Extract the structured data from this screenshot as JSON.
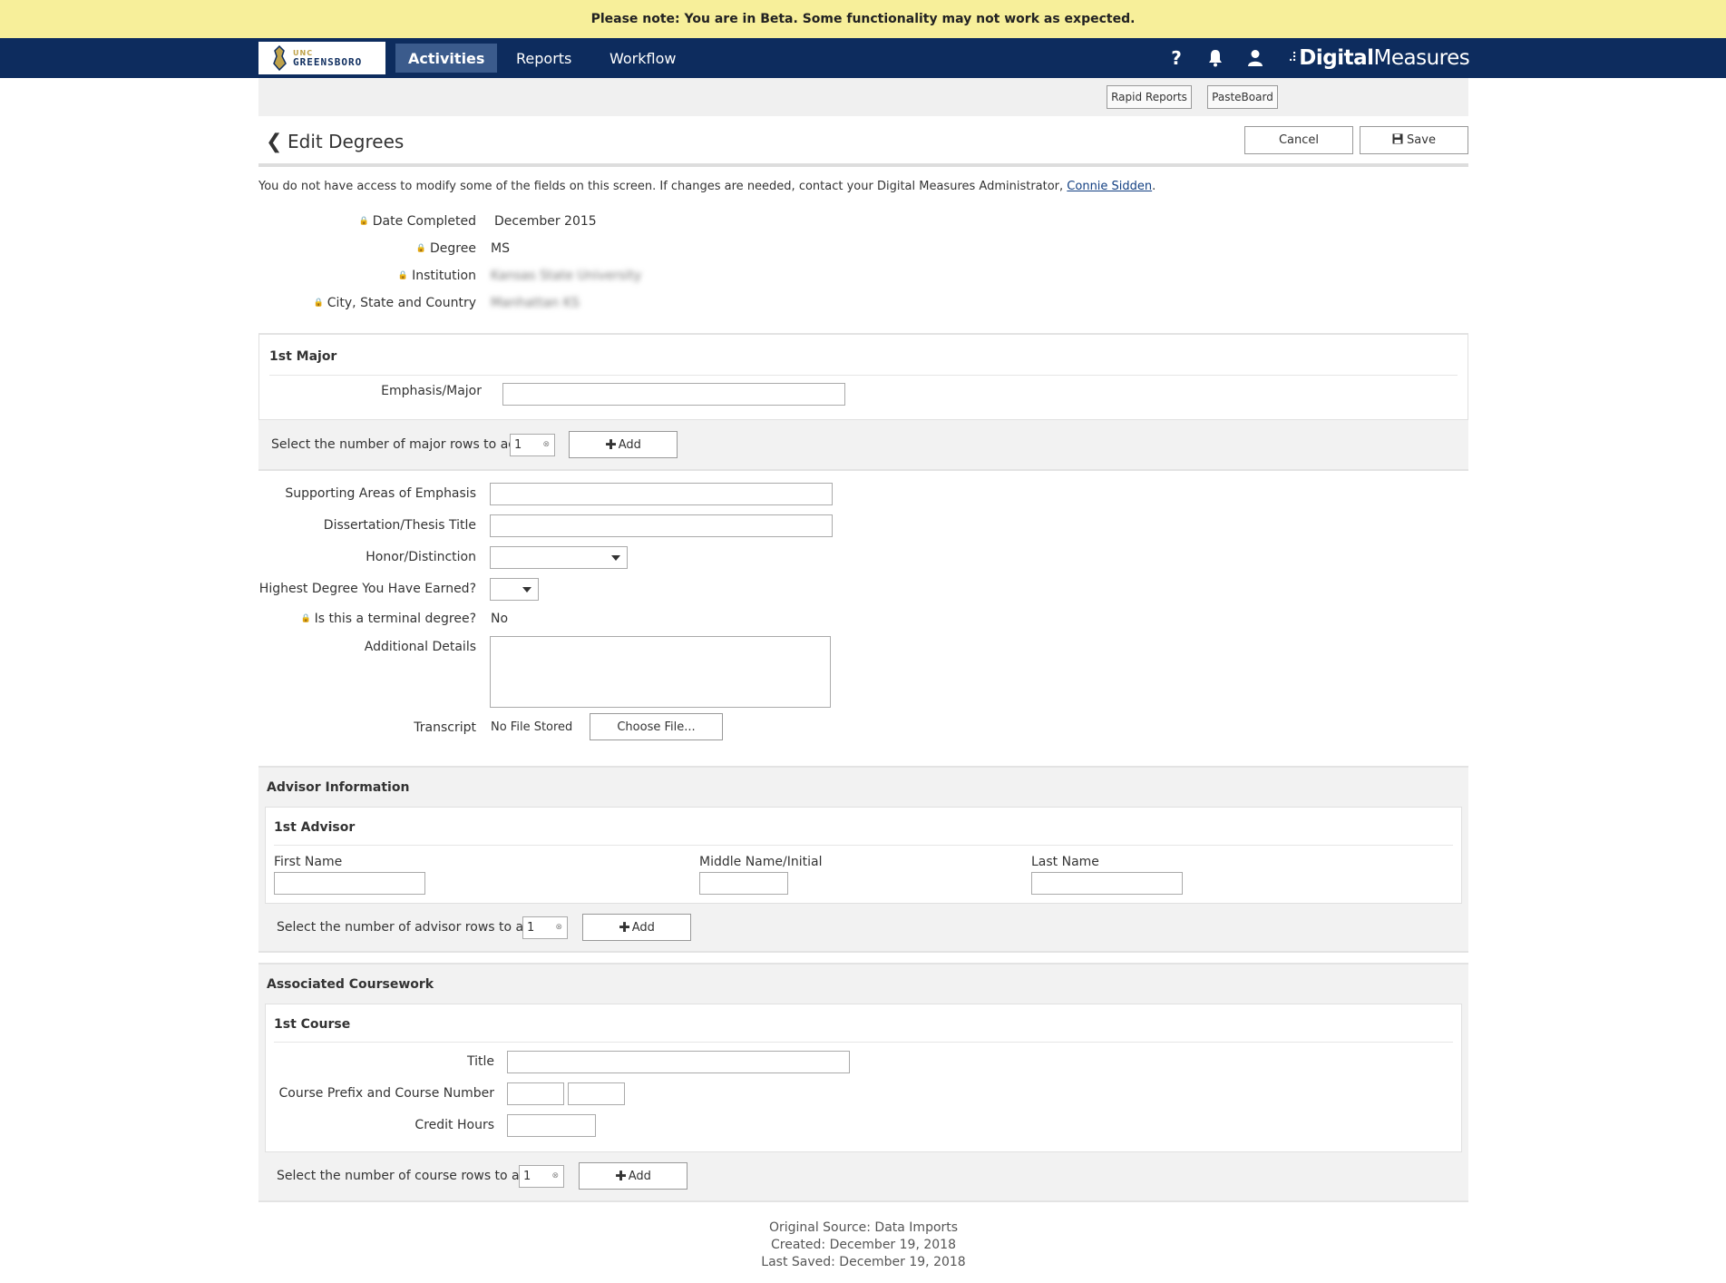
{
  "banner": {
    "text": "Please note: You are in Beta. Some functionality may not work as expected."
  },
  "nav": {
    "logo_unc": "UNC",
    "logo_name": "GREENSBORO",
    "items": [
      "Activities",
      "Reports",
      "Workflow"
    ],
    "help_icon": "?",
    "brand_prefix": "Digital",
    "brand_suffix": "Measures"
  },
  "toolbar": {
    "rapid_reports": "Rapid Reports",
    "pasteboard": "PasteBoard"
  },
  "header": {
    "title": "Edit Degrees",
    "cancel": "Cancel",
    "save": "Save"
  },
  "notice": {
    "text": "You do not have access to modify some of the fields on this screen. If changes are needed, contact your Digital Measures Administrator, ",
    "link": "Connie Sidden",
    "end": "."
  },
  "readonly": {
    "date_label": "Date Completed",
    "date_value": "December 2015",
    "degree_label": "Degree",
    "degree_value": "MS",
    "institution_label": "Institution",
    "institution_value": "Kansas State University",
    "city_label": "City, State and Country",
    "city_value": "Manhattan KS"
  },
  "major": {
    "section_title": "1st Major",
    "emphasis_label": "Emphasis/Major",
    "rows_label": "Select the number of major rows to add:",
    "rows_value": "1",
    "add_label": "Add"
  },
  "details": {
    "supporting_label": "Supporting Areas of Emphasis",
    "dissertation_label": "Dissertation/Thesis Title",
    "honor_label": "Honor/Distinction",
    "highest_label": "Highest Degree You Have Earned?",
    "terminal_label": "Is this a terminal degree?",
    "terminal_value": "No",
    "additional_label": "Additional Details",
    "transcript_label": "Transcript",
    "transcript_value": "No File Stored",
    "choose_file": "Choose File..."
  },
  "advisor": {
    "section_title": "Advisor Information",
    "sub_title": "1st Advisor",
    "first_label": "First Name",
    "middle_label": "Middle Name/Initial",
    "last_label": "Last Name",
    "rows_label": "Select the number of advisor rows to add:",
    "rows_value": "1",
    "add_label": "Add"
  },
  "coursework": {
    "section_title": "Associated Coursework",
    "sub_title": "1st Course",
    "title_label": "Title",
    "prefix_label": "Course Prefix and Course Number",
    "credit_label": "Credit Hours",
    "rows_label": "Select the number of course rows to add:",
    "rows_value": "1",
    "add_label": "Add"
  },
  "footer": {
    "source": "Original Source: Data Imports",
    "created": "Created: December 19, 2018",
    "saved": "Last Saved: December 19, 2018"
  }
}
